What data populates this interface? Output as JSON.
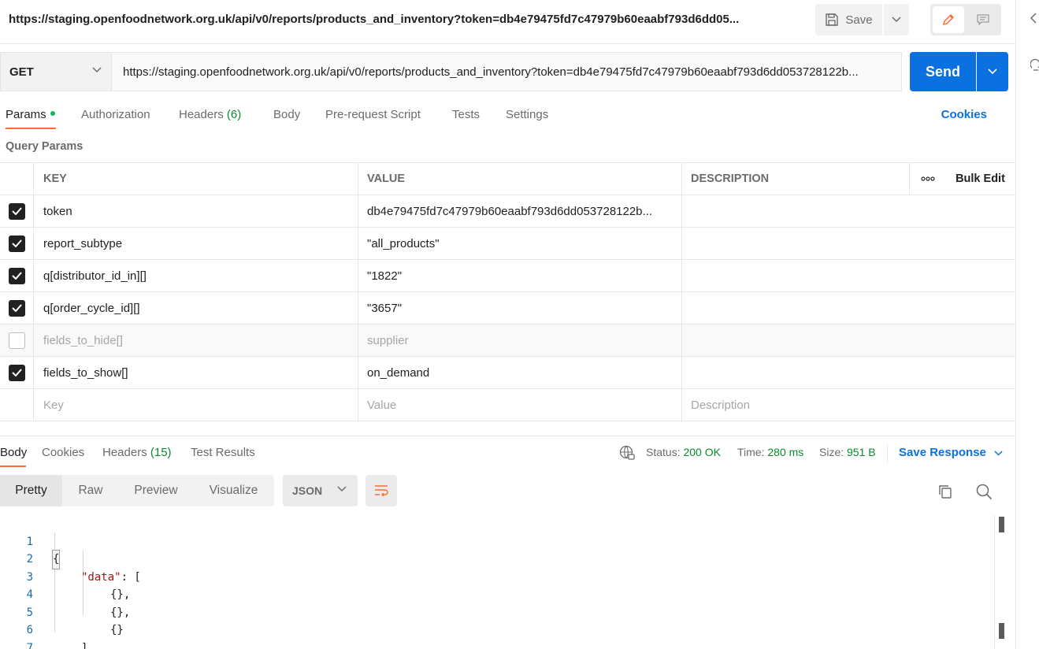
{
  "request": {
    "title": "https://staging.openfoodnetwork.org.uk/api/v0/reports/products_and_inventory?token=db4e79475fd7c47979b60eaabf793d6dd05...",
    "method": "GET",
    "url": "https://staging.openfoodnetwork.org.uk/api/v0/reports/products_and_inventory?token=db4e79475fd7c47979b60eaabf793d6dd053728122b...",
    "save_label": "Save",
    "send_label": "Send"
  },
  "request_tabs": {
    "params": "Params",
    "authorization": "Authorization",
    "headers": "Headers",
    "headers_count": "(6)",
    "body": "Body",
    "pre_request": "Pre-request Script",
    "tests": "Tests",
    "settings": "Settings",
    "cookies": "Cookies"
  },
  "params": {
    "section_label": "Query Params",
    "columns": {
      "key": "KEY",
      "value": "VALUE",
      "description": "DESCRIPTION",
      "bulk_edit": "Bulk Edit"
    },
    "rows": [
      {
        "key": "token",
        "value": "db4e79475fd7c47979b60eaabf793d6dd053728122b...",
        "enabled": true
      },
      {
        "key": "report_subtype",
        "value": "\"all_products\"",
        "enabled": true
      },
      {
        "key": "q[distributor_id_in][]",
        "value": "\"1822\"",
        "enabled": true
      },
      {
        "key": "q[order_cycle_id][]",
        "value": "\"3657\"",
        "enabled": true
      },
      {
        "key": "fields_to_hide[]",
        "value": "supplier",
        "enabled": false
      },
      {
        "key": "fields_to_show[]",
        "value": "on_demand",
        "enabled": true
      }
    ],
    "placeholders": {
      "key": "Key",
      "value": "Value",
      "description": "Description"
    }
  },
  "response": {
    "tabs": {
      "body": "Body",
      "cookies": "Cookies",
      "headers": "Headers",
      "headers_count": "(15)",
      "test_results": "Test Results"
    },
    "status_label": "Status:",
    "status_value": "200 OK",
    "time_label": "Time:",
    "time_value": "280 ms",
    "size_label": "Size:",
    "size_value": "951 B",
    "save_response": "Save Response",
    "views": {
      "pretty": "Pretty",
      "raw": "Raw",
      "preview": "Preview",
      "visualize": "Visualize"
    },
    "format": "JSON",
    "code_lines": [
      {
        "n": "1",
        "text": "{"
      },
      {
        "n": "2",
        "key": "\"data\"",
        "rest": ": ["
      },
      {
        "n": "3",
        "text": "{},"
      },
      {
        "n": "4",
        "text": "{},"
      },
      {
        "n": "5",
        "text": "{}"
      },
      {
        "n": "6",
        "text": "]"
      },
      {
        "n": "7",
        "text": "}"
      }
    ]
  },
  "colors": {
    "accent_blue": "#0c71e0",
    "tab_underline": "#ff6c37",
    "success_green": "#0a8a2e",
    "json_key": "#a31515"
  }
}
